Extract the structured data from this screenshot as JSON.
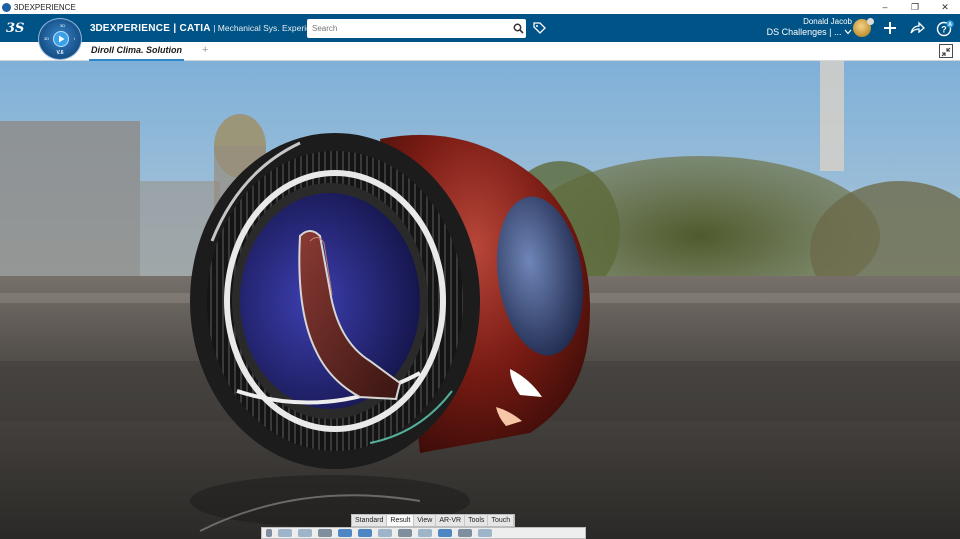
{
  "window": {
    "title": "3DEXPERIENCE",
    "controls": {
      "minimize": "–",
      "restore": "❐",
      "close": "✕"
    }
  },
  "topbar": {
    "logo": "3S",
    "brand_bold": "3D",
    "brand_main": "EXPERIENCE | CATIA",
    "brand_sub": " | Mechanical Sys. Experie...",
    "search_placeholder": "Search",
    "user_name": "Donald Jacob",
    "context": "DS Challenges | ...",
    "help_badge": "A",
    "icons": [
      "search-icon",
      "tag-icon",
      "avatar",
      "add-icon",
      "share-icon",
      "help-icon"
    ]
  },
  "compass": {
    "version": "V.6",
    "labels": {
      "top": "3D",
      "left": "3D",
      "right": "i"
    }
  },
  "tabs": {
    "active": "Diroll  Clima. Solution",
    "add": "+"
  },
  "action_bar": {
    "tabs": [
      "Standard",
      "Result",
      "View",
      "AR-VR",
      "Tools",
      "Touch"
    ],
    "active_tab": "Result"
  },
  "colors": {
    "topbar": "#005386",
    "tab_underline": "#2f86c8",
    "vehicle_body": "#7a1c14",
    "wheel": "#1c1c1c",
    "cabin": "#2a2a8a"
  }
}
